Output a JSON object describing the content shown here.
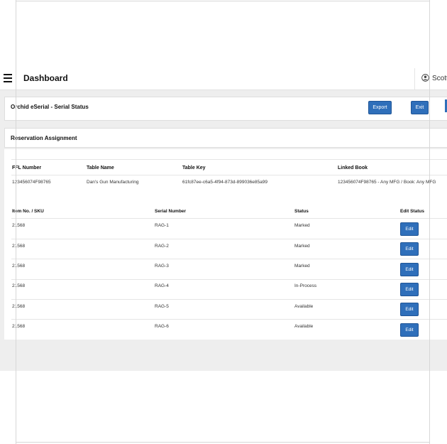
{
  "header": {
    "title": "Dashboard",
    "user_name": "Scott",
    "menu_icon": "hamburger-icon",
    "user_icon": "user-circle-icon"
  },
  "serial_status": {
    "title": "Orchid eSerial - Serial Status",
    "export_label": "Export",
    "exit_label": "Exit"
  },
  "reservation": {
    "title": "Reservation Assignment"
  },
  "info_table": {
    "headers": [
      "FFL Number",
      "Table Name",
      "Table Key",
      "Linked Book"
    ],
    "row": [
      "123456074F98765",
      "Dan's Gun Manufacturing",
      "61fc87ee-c6a5-4f94-873d-899036e85a99",
      "123456074F98765 - Any MFG / Book: Any MFG"
    ]
  },
  "items_table": {
    "headers": [
      "Item No. / SKU",
      "Serial Number",
      "Status",
      "Edit Status"
    ],
    "edit_label": "Edit",
    "rows": [
      {
        "sku": "21568",
        "serial": "RAG-1",
        "status": "Marked"
      },
      {
        "sku": "21568",
        "serial": "RAG-2",
        "status": "Marked"
      },
      {
        "sku": "21568",
        "serial": "RAG-3",
        "status": "Marked"
      },
      {
        "sku": "21568",
        "serial": "RAG-4",
        "status": "In-Process"
      },
      {
        "sku": "21568",
        "serial": "RAG-5",
        "status": "Available"
      },
      {
        "sku": "21568",
        "serial": "RAG-6",
        "status": "Available"
      }
    ]
  },
  "colors": {
    "primary_button": "#2f6fba",
    "page_background": "#eeeeee"
  }
}
